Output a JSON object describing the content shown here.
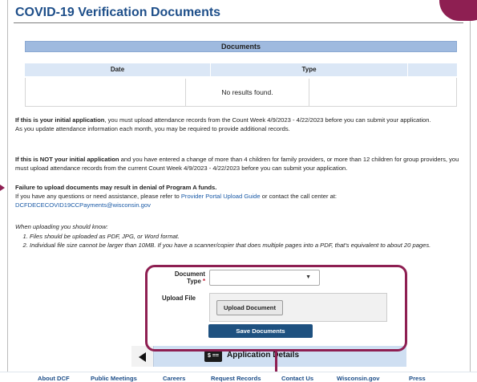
{
  "title": "COVID-19 Verification Documents",
  "documents_table": {
    "caption": "Documents",
    "headers": [
      "Date",
      "Type"
    ],
    "empty_message": "No results found."
  },
  "notices": {
    "initial_bold": "If this is your initial application",
    "initial_rest": ", you must upload attendance records from the Count Week 4/9/2023 - 4/22/2023 before you can submit your application.",
    "initial_line2": "As you update attendance information each month, you may be required to provide additional records.",
    "not_initial_bold": "If this is NOT your initial application",
    "not_initial_rest": " and you have entered a change of more than 4 children for family providers, or more than 12 children for group providers, you must upload attendance records from the current Count Week 4/9/2023 - 4/22/2023 before you can submit your application.",
    "failure_bold": "Failure to upload documents may result in denial of Program A funds.",
    "assistance_pre": "If you have any questions or need assistance, please refer to ",
    "assistance_link": "Provider Portal Upload Guide",
    "assistance_mid": " or contact the call center at:",
    "assistance_email": "DCFDECECOVID19CCPayments@wisconsin.gov"
  },
  "instructions": {
    "intro": "When uploading you should know:",
    "items": [
      "Files should be uploaded as PDF, JPG, or Word format.",
      "Individual file size cannot be larger than 10MB. If you have a scanner/copier that does multiple pages into a PDF, that's equivalent to about 20 pages."
    ]
  },
  "form": {
    "document_type_label_1": "Document",
    "document_type_label_2": "Type",
    "required_mark": "*",
    "document_type_value": "",
    "upload_file_label": "Upload File",
    "upload_button": "Upload Document",
    "save_button": "Save Documents"
  },
  "app_bar": {
    "icon_text": "$ ==",
    "label": "Application Details"
  },
  "footer": {
    "links": [
      "About DCF",
      "Public Meetings",
      "Careers",
      "Request Records",
      "Contact Us",
      "Wisconsin.gov",
      "Press"
    ]
  },
  "colors": {
    "accent": "#8e1f52",
    "title_blue": "#1d4e89",
    "save_button": "#1e5180",
    "table_caption": "#9fbadf"
  }
}
